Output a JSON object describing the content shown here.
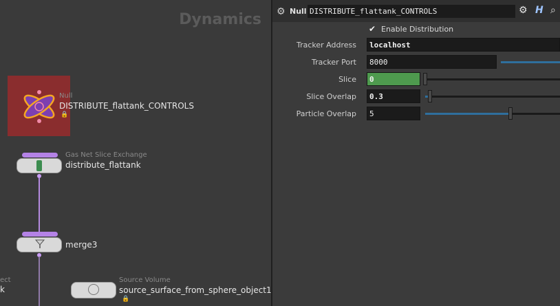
{
  "network": {
    "title": "Dynamics",
    "nodes": [
      {
        "type": "Null",
        "name": "DISTRIBUTE_flattank_CONTROLS"
      },
      {
        "type": "Gas Net Slice Exchange",
        "name": "distribute_flattank"
      },
      {
        "type": "",
        "name": "merge3"
      },
      {
        "type": "Source Volume",
        "name": "source_surface_from_sphere_object1"
      },
      {
        "type": "ect",
        "name": "k"
      }
    ]
  },
  "param_panel": {
    "node_type": "Null",
    "node_name": "DISTRIBUTE_flattank_CONTROLS",
    "icons": [
      "gear-icon",
      "help-icon",
      "search-icon"
    ],
    "enable_distribution": {
      "label": "Enable Distribution",
      "checked": true,
      "checkmark": "✔"
    },
    "tracker_address": {
      "label": "Tracker Address",
      "value": "localhost"
    },
    "tracker_port": {
      "label": "Tracker Port",
      "value": "8000"
    },
    "slice": {
      "label": "Slice",
      "value": "0"
    },
    "slice_overlap": {
      "label": "Slice Overlap",
      "value": "0.3"
    },
    "particle_overlap": {
      "label": "Particle Overlap",
      "value": "5"
    }
  },
  "colors": {
    "selection": "#8a2d2e",
    "accent_purple": "#b482e6",
    "slice_field": "#4e9a4e",
    "slider_blue": "#2f6f9d"
  }
}
